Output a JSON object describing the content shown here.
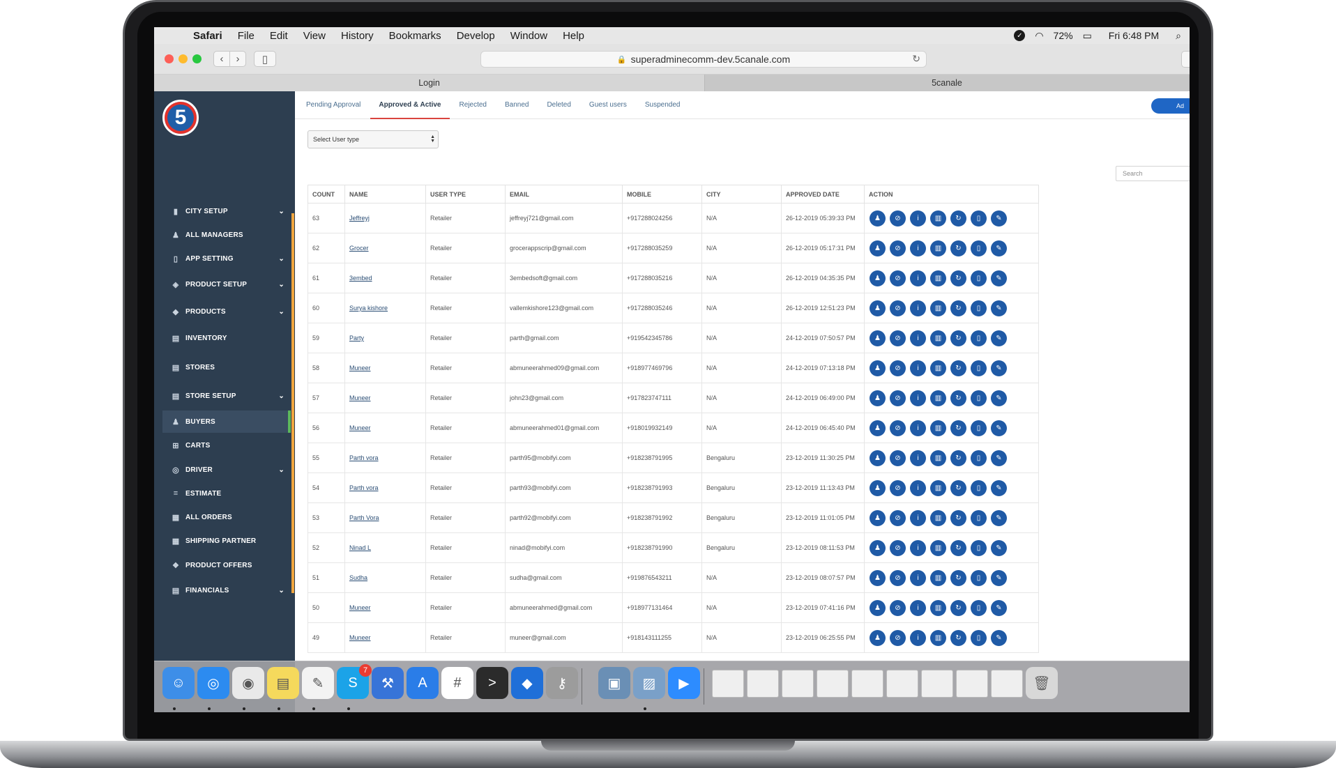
{
  "menubar": {
    "app": "Safari",
    "items": [
      "File",
      "Edit",
      "View",
      "History",
      "Bookmarks",
      "Develop",
      "Window",
      "Help"
    ],
    "battery": "72%",
    "clock": "Fri 6:48 PM"
  },
  "browser": {
    "url": "superadminecomm-dev.5canale.com",
    "tabs": [
      "Login",
      "5canale"
    ]
  },
  "sidebar": {
    "items": [
      {
        "label": "CITY SETUP",
        "icon": "bar-chart-icon",
        "chevron": true
      },
      {
        "label": "ALL MANAGERS",
        "icon": "managers-icon",
        "chevron": false
      },
      {
        "label": "APP SETTING",
        "icon": "mobile-icon",
        "chevron": true
      },
      {
        "label": "PRODUCT SETUP",
        "icon": "dropbox-icon",
        "chevron": true
      },
      {
        "label": "PRODUCTS",
        "icon": "cube-icon",
        "chevron": true
      },
      {
        "label": "INVENTORY",
        "icon": "store-icon",
        "chevron": false
      },
      {
        "label": "STORES",
        "icon": "store-icon",
        "chevron": false
      },
      {
        "label": "STORE SETUP",
        "icon": "store-icon",
        "chevron": true
      },
      {
        "label": "BUYERS",
        "icon": "buyers-icon",
        "chevron": false
      },
      {
        "label": "CARTS",
        "icon": "cart-icon",
        "chevron": false
      },
      {
        "label": "DRIVER",
        "icon": "driver-icon",
        "chevron": true
      },
      {
        "label": "ESTIMATE",
        "icon": "list-icon",
        "chevron": false
      },
      {
        "label": "ALL ORDERS",
        "icon": "orders-icon",
        "chevron": false
      },
      {
        "label": "SHIPPING PARTNER",
        "icon": "orders-icon",
        "chevron": false
      },
      {
        "label": "PRODUCT OFFERS",
        "icon": "offers-icon",
        "chevron": false
      },
      {
        "label": "FINANCIALS",
        "icon": "financials-icon",
        "chevron": true
      }
    ],
    "active_index": 8
  },
  "page_tabs": [
    "Pending Approval",
    "Approved & Active",
    "Rejected",
    "Banned",
    "Deleted",
    "Guest users",
    "Suspended"
  ],
  "active_tab": "Approved & Active",
  "add_button": "Ad",
  "filter": {
    "select_value": "Select User type"
  },
  "search": {
    "placeholder": "Search"
  },
  "table": {
    "columns": [
      "COUNT",
      "NAME",
      "USER TYPE",
      "EMAIL",
      "MOBILE",
      "CITY",
      "APPROVED DATE",
      "ACTION"
    ],
    "rows": [
      [
        "63",
        "Jeffreyj",
        "Retailer",
        "jeffreyj721@gmail.com",
        "+917288024256",
        "N/A",
        "26-12-2019 05:39:33 PM"
      ],
      [
        "62",
        "Grocer",
        "Retailer",
        "grocerappscrip@gmail.com",
        "+917288035259",
        "N/A",
        "26-12-2019 05:17:31 PM"
      ],
      [
        "61",
        "3embed",
        "Retailer",
        "3embedsoft@gmail.com",
        "+917288035216",
        "N/A",
        "26-12-2019 04:35:35 PM"
      ],
      [
        "60",
        "Surya kishore",
        "Retailer",
        "vallemkishore123@gmail.com",
        "+917288035246",
        "N/A",
        "26-12-2019 12:51:23 PM"
      ],
      [
        "59",
        "Party",
        "Retailer",
        "parth@gmail.com",
        "+919542345786",
        "N/A",
        "24-12-2019 07:50:57 PM"
      ],
      [
        "58",
        "Muneer",
        "Retailer",
        "abmuneerahmed09@gmail.com",
        "+918977469796",
        "N/A",
        "24-12-2019 07:13:18 PM"
      ],
      [
        "57",
        "Muneer",
        "Retailer",
        "john23@gmail.com",
        "+917823747111",
        "N/A",
        "24-12-2019 06:49:00 PM"
      ],
      [
        "56",
        "Muneer",
        "Retailer",
        "abmuneerahmed01@gmail.com",
        "+918019932149",
        "N/A",
        "24-12-2019 06:45:40 PM"
      ],
      [
        "55",
        "Parth vora",
        "Retailer",
        "parth95@mobifyi.com",
        "+918238791995",
        "Bengaluru",
        "23-12-2019 11:30:25 PM"
      ],
      [
        "54",
        "Parth vora",
        "Retailer",
        "parth93@mobifyi.com",
        "+918238791993",
        "Bengaluru",
        "23-12-2019 11:13:43 PM"
      ],
      [
        "53",
        "Parth Vora",
        "Retailer",
        "parth92@mobifyi.com",
        "+918238791992",
        "Bengaluru",
        "23-12-2019 11:01:05 PM"
      ],
      [
        "52",
        "Ninad L",
        "Retailer",
        "ninad@mobifyi.com",
        "+918238791990",
        "Bengaluru",
        "23-12-2019 08:11:53 PM"
      ],
      [
        "51",
        "Sudha",
        "Retailer",
        "sudha@gmail.com",
        "+919876543211",
        "N/A",
        "23-12-2019 08:07:57 PM"
      ],
      [
        "50",
        "Muneer",
        "Retailer",
        "abmuneerahmed@gmail.com",
        "+918977131464",
        "N/A",
        "23-12-2019 07:41:16 PM"
      ],
      [
        "49",
        "Muneer",
        "Retailer",
        "muneer@gmail.com",
        "+918143111255",
        "N/A",
        "23-12-2019 06:25:55 PM"
      ]
    ],
    "action_icons": [
      "user-icon",
      "ban-icon",
      "info-icon",
      "trash-icon",
      "refresh-icon",
      "mobile-icon",
      "edit-icon"
    ]
  },
  "dock": {
    "apps": [
      "Finder",
      "Safari",
      "Chrome",
      "Notes",
      "TextEdit",
      "Skype",
      "Xcode",
      "App Store",
      "Slack",
      "Terminal",
      "Maps",
      "Keychain",
      "Preview",
      "Photos",
      "Zoom"
    ],
    "skype_badge": "7"
  },
  "colors": {
    "sidebar": "#2d3e50",
    "action": "#1f5aa6",
    "active_tab_underline": "#d9443e",
    "accent": "#f0a640"
  }
}
